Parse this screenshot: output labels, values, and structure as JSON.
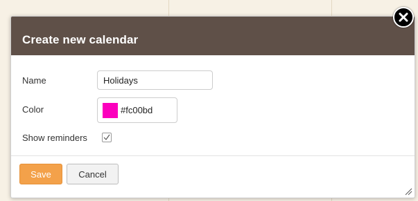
{
  "dialog": {
    "title": "Create new calendar",
    "fields": {
      "name_label": "Name",
      "name_value": "Holidays",
      "color_label": "Color",
      "color_value": "#fc00bd",
      "show_reminders_label": "Show reminders",
      "show_reminders_checked": true
    },
    "buttons": {
      "save_label": "Save",
      "cancel_label": "Cancel"
    },
    "icons": {
      "close": "close-icon",
      "checkbox": "checkmark-icon",
      "resize": "resize-grip-icon"
    }
  },
  "colors": {
    "header_bg": "#5f5048",
    "save_bg": "#f3a14a",
    "swatch": "#fc00bd",
    "page_bg": "#f7f1e5"
  }
}
